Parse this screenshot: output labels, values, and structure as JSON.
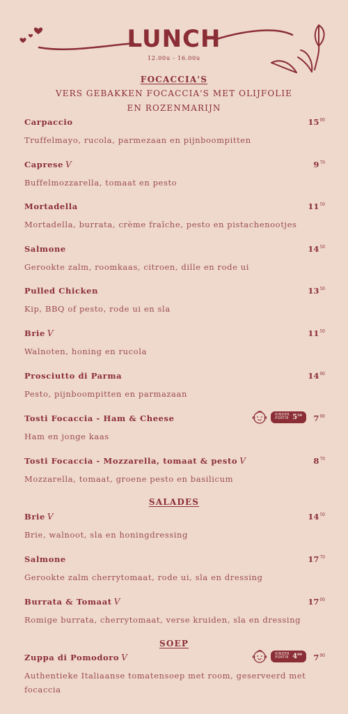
{
  "header": {
    "title": "LUNCH",
    "hours": "12.00u - 16.00u"
  },
  "sections": [
    {
      "title": "FOCACCIA'S",
      "subtitle_lines": [
        "VERS GEBAKKEN FOCACCIA'S MET OLIJFOLIE",
        "EN ROZENMARIJN"
      ],
      "items": [
        {
          "name": "Carpaccio",
          "desc": "Truffelmayo, rucola, parmezaan en pijnboompitten",
          "price_main": "15",
          "price_cents": "90"
        },
        {
          "name": "Caprese",
          "veg": true,
          "desc": "Buffelmozzarella, tomaat en pesto",
          "price_main": "9",
          "price_cents": "70"
        },
        {
          "name": "Mortadella",
          "desc": "Mortadella, burrata, crème fraîche, pesto en pistachenootjes",
          "price_main": "11",
          "price_cents": "50"
        },
        {
          "name": "Salmone",
          "desc": "Gerookte zalm, roomkaas, citroen, dille en rode ui",
          "price_main": "14",
          "price_cents": "50"
        },
        {
          "name": "Pulled Chicken",
          "desc": "Kip, BBQ of pesto, rode ui en sla",
          "price_main": "13",
          "price_cents": "50"
        },
        {
          "name": "Brie",
          "veg": true,
          "desc": "Walnoten, honing en rucola",
          "price_main": "11",
          "price_cents": "50"
        },
        {
          "name": "Prosciutto di Parma",
          "desc": "Pesto, pijnboompitten en parmazaan",
          "price_main": "14",
          "price_cents": "90"
        },
        {
          "name": "Tosti Focaccia - Ham & Cheese",
          "desc": "Ham en jonge kaas",
          "price_main": "7",
          "price_cents": "90",
          "kids": {
            "label_line1": "KINDER",
            "label_line2": "PORTIE",
            "price_main": "5",
            "price_cents": "50"
          }
        },
        {
          "name": "Tosti Focaccia - Mozzarella, tomaat & pesto",
          "veg": true,
          "desc": "Mozzarella, tomaat, groene pesto en basilicum",
          "price_main": "8",
          "price_cents": "70"
        }
      ]
    },
    {
      "title": "SALADES",
      "items": [
        {
          "name": "Brie",
          "veg": true,
          "desc": "Brie, walnoot, sla en honingdressing",
          "price_main": "14",
          "price_cents": "50"
        },
        {
          "name": "Salmone",
          "desc": "Gerookte zalm cherrytomaat, rode ui, sla en dressing",
          "price_main": "17",
          "price_cents": "70"
        },
        {
          "name": "Burrata & Tomaat",
          "veg": true,
          "desc": "Romige burrata, cherrytomaat, verse kruiden, sla en dressing",
          "price_main": "17",
          "price_cents": "00"
        }
      ]
    },
    {
      "title": "SOEP",
      "items": [
        {
          "name": "Zuppa di Pomodoro",
          "veg": true,
          "desc": "Authentieke Italiaanse tomatensoep met room, geserveerd met focaccia",
          "price_main": "7",
          "price_cents": "90",
          "kids": {
            "label_line1": "KINDER",
            "label_line2": "PORTIE",
            "price_main": "4",
            "price_cents": "00"
          }
        }
      ]
    }
  ],
  "icons": {
    "veg": "vegetarian-v-leaf-icon",
    "kid": "child-face-icon",
    "decor": "hearts-and-leaves-decoration"
  },
  "colors": {
    "background": "#efd9cc",
    "accent": "#8a2d35",
    "text": "#9a4a50"
  }
}
